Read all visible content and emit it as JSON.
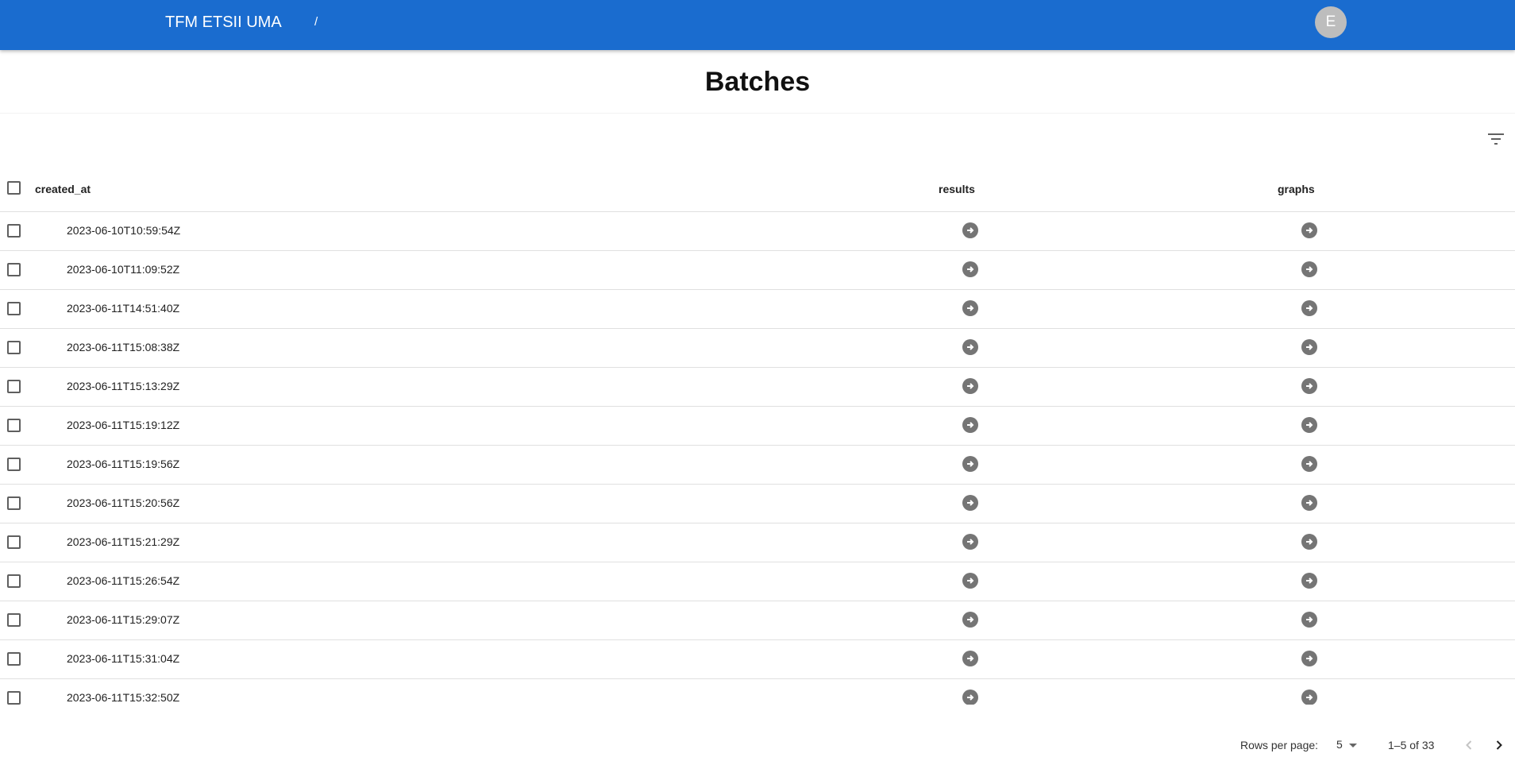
{
  "appbar": {
    "title": "TFM ETSII UMA",
    "breadcrumb_separator": "/",
    "avatar_letter": "E",
    "color": "#1a6ccf"
  },
  "page": {
    "title": "Batches"
  },
  "toolbar": {
    "filter_icon": "filter-list-icon"
  },
  "table": {
    "columns": [
      "created_at",
      "results",
      "graphs"
    ],
    "row_action_icon": "arrow-circle-right-icon",
    "rows": [
      "2023-06-10T10:59:54Z",
      "2023-06-10T11:09:52Z",
      "2023-06-11T14:51:40Z",
      "2023-06-11T15:08:38Z",
      "2023-06-11T15:13:29Z",
      "2023-06-11T15:19:12Z",
      "2023-06-11T15:19:56Z",
      "2023-06-11T15:20:56Z",
      "2023-06-11T15:21:29Z",
      "2023-06-11T15:26:54Z",
      "2023-06-11T15:29:07Z",
      "2023-06-11T15:31:04Z",
      "2023-06-11T15:32:50Z"
    ]
  },
  "pagination": {
    "rows_per_page_label": "Rows per page:",
    "rows_per_page_value": "5",
    "range_text": "1–5 of 33"
  }
}
